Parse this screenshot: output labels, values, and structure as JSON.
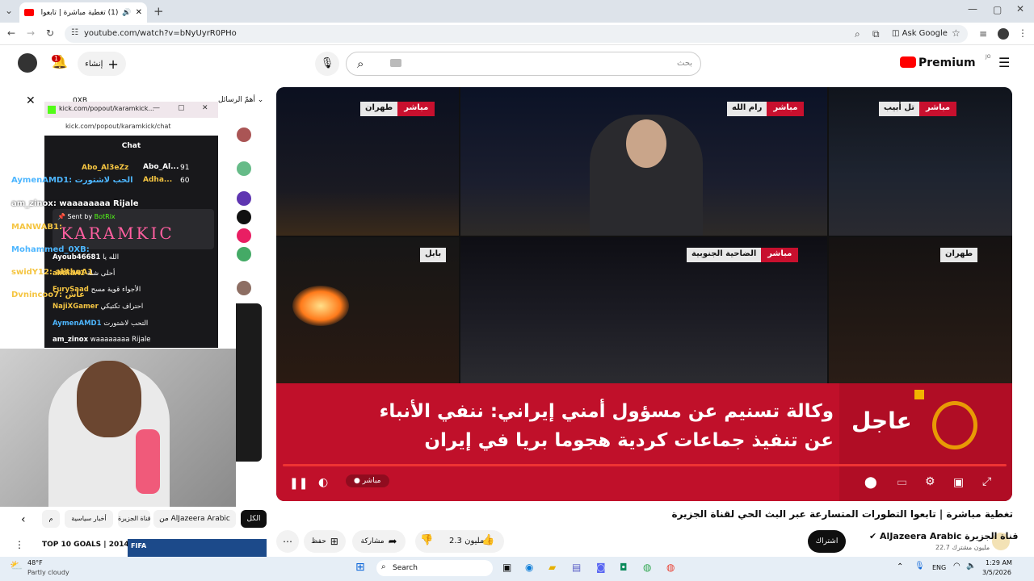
{
  "browser": {
    "tab_title": "(1) تغطية مباشرة | تابعوا التطو",
    "url": "youtube.com/watch?v=bNyUyrR0PHo",
    "ask_google": "Ask Google"
  },
  "yt_header": {
    "notif_count": "1",
    "create_label": "إنشاء",
    "search_placeholder": "بحث",
    "premium": "Premium",
    "jo": "JO"
  },
  "player": {
    "cells": [
      {
        "tag": "مباشر",
        "city": "طهران"
      },
      {
        "tag": "مباشر",
        "city": "رام الله"
      },
      {
        "tag": "مباشر",
        "city": "تل أبيب"
      },
      {
        "tag": "",
        "city": "بابل"
      },
      {
        "tag": "مباشر",
        "city": "الضاحية الجنوبية"
      },
      {
        "tag": "",
        "city": "طهران"
      }
    ],
    "ajil": "عاجل",
    "headline1": "وكالة تسنيم عن مسؤول أمني إيراني: ننفي الأنباء",
    "headline2": "عن تنفيذ جماعات كردية هجوما بريا في إيران",
    "live_label": "مباشر"
  },
  "video": {
    "title": "تغطية مباشرة | تابعوا التطورات المتسارعة عبر البث الحي لقناة الجزيرة",
    "channel_ar": "قناة الجزيرة",
    "channel_en": "AlJazeera Arabic",
    "subs": "22.7 مليون مشترك",
    "subscribe": "اشتراك",
    "likes": "2.3 مليون",
    "share": "مشاركة",
    "save": "حفظ"
  },
  "chips": [
    "الكل",
    "من AlJazeera Arabic",
    "قناة الجزيرة",
    "أخبار سياسية",
    "م"
  ],
  "side_video": {
    "title": "TOP 10 GOALS | 2014",
    "badge": "FIFA"
  },
  "yt_chat": {
    "header": "أهمّ الرسائل",
    "user": "0XB"
  },
  "kick": {
    "window_title": "kick.com/popout/karamkick...",
    "url": "kick.com/popout/karamkick/chat",
    "chat_label": "Chat",
    "leaderboard": [
      {
        "name": "Abo_Al3eZz",
        "value": "91"
      },
      {
        "name": "Abo_Al...",
        "value": ""
      },
      {
        "name": "Adha...",
        "value": "60"
      }
    ],
    "sent_by": "Sent by",
    "sent_user": "BotRix",
    "logo": "KARAMKIC",
    "lines": [
      {
        "user": "Ayoub46681",
        "msg": "الله يا"
      },
      {
        "user": "alithaA1",
        "msg": "أحلى شلة"
      },
      {
        "user": "FurySaad",
        "msg": "الأجواء قوية مسح"
      },
      {
        "user": "NajiXGamer",
        "msg": "احتراف تكتيكي"
      },
      {
        "user": "AymenAMD1",
        "msg": "التحب لاشتورت"
      },
      {
        "user": "am_zinox",
        "msg": "waaaaaaaa Rijale"
      }
    ]
  },
  "overlay_msgs": [
    {
      "text": "AymenAMD1: الحب لاشتورت",
      "color": "#4db6ff"
    },
    {
      "text": "am_zinox: waaaaaaaa Rijale",
      "color": "#ffffff"
    },
    {
      "text": "MANWAB1:",
      "color": "#f5c542"
    },
    {
      "text": "Mohammed_0XB:",
      "color": "#4db6ff"
    },
    {
      "text": "swidY12: alithaA1",
      "color": "#f5c542"
    },
    {
      "text": "Dvnincoo7: عاش",
      "color": "#f5c542"
    }
  ],
  "taskbar": {
    "temp": "48°F",
    "weather": "Partly cloudy",
    "search": "Search",
    "lang": "ENG",
    "time": "1:29 AM",
    "date": "3/5/2026"
  }
}
